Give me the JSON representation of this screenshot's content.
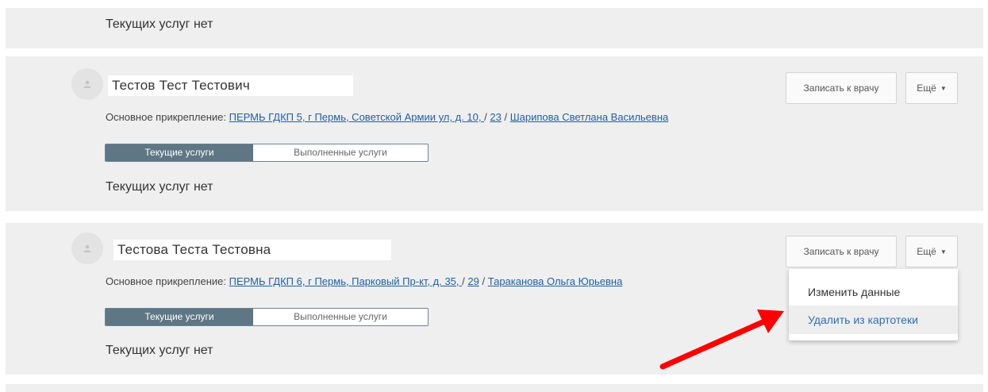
{
  "top_card": {
    "no_services": "Текущих услуг нет"
  },
  "patients": [
    {
      "name": "Тестов Тест Тестович",
      "attach_label": "Основное прикрепление:",
      "clinic_link": "ПЕРМЬ ГДКП 5, г Пермь, Советской Армии ул, д. 10, ",
      "sep1": "/",
      "site_link": "23",
      "sep2": "/",
      "doctor_link": "Шарипова Светлана Васильевна",
      "tab_current": "Текущие услуги",
      "tab_done": "Выполненные услуги",
      "no_services": "Текущих услуг нет",
      "book_button": "Записать к врачу",
      "more_button": "Ещё"
    },
    {
      "name": "Тестова Теста Тестовна",
      "attach_label": "Основное прикрепление:",
      "clinic_link": "ПЕРМЬ ГДКП 6, г Пермь, Парковый Пр-кт, д. 35, ",
      "sep1": "/",
      "site_link": "29",
      "sep2": "/",
      "doctor_link": "Тараканова Ольга Юрьевна",
      "tab_current": "Текущие услуги",
      "tab_done": "Выполненные услуги",
      "no_services": "Текущих услуг нет",
      "book_button": "Записать к врачу",
      "more_button": "Ещё"
    }
  ],
  "dropdown": {
    "items": [
      "Изменить данные",
      "Удалить из картотеки"
    ]
  },
  "icons": {
    "avatar": "user-icon",
    "caret": "caret-down-icon",
    "annotation": "red-arrow-icon"
  },
  "colors": {
    "card_bg": "#efefef",
    "tab_active_bg": "#5f7684",
    "link": "#1f5fa8",
    "arrow": "#ff0000"
  }
}
